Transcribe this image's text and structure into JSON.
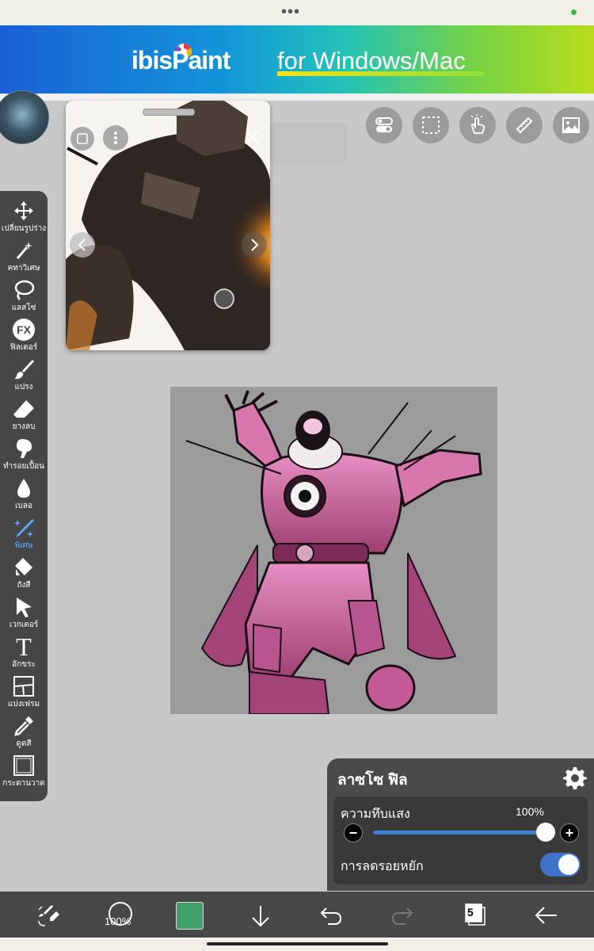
{
  "status_bar": {
    "dots": "•••",
    "indicator_color": "#2fbf4f"
  },
  "banner": {
    "brand": "ibisPaint",
    "slogan": "for Windows/Mac"
  },
  "toolbar": {
    "items": [
      {
        "label": "เปลี่ยนรูปร่าง",
        "icon": "move-arrows-icon"
      },
      {
        "label": "คทาวิเศษ",
        "icon": "magic-wand-icon"
      },
      {
        "label": "แลสโซ่",
        "icon": "lasso-icon"
      },
      {
        "label": "ฟิลเตอร์",
        "icon": "fx-filter-icon",
        "glyph": "FX"
      },
      {
        "label": "แปรง",
        "icon": "brush-icon"
      },
      {
        "label": "ยางลบ",
        "icon": "eraser-icon"
      },
      {
        "label": "ทำรอยเปื้อน",
        "icon": "smudge-icon"
      },
      {
        "label": "เบลอ",
        "icon": "blur-drop-icon"
      },
      {
        "label": "พิเศษ",
        "icon": "special-pen-icon",
        "active": true
      },
      {
        "label": "ถังสี",
        "icon": "fill-bucket-icon"
      },
      {
        "label": "เวกเตอร์",
        "icon": "vector-cursor-icon"
      },
      {
        "label": "อักขระ",
        "icon": "text-icon",
        "glyph": "T"
      },
      {
        "label": "แบ่งเฟรม",
        "icon": "frame-divider-icon"
      },
      {
        "label": "ดูดสี",
        "icon": "eyedropper-icon"
      },
      {
        "label": "กระดานวาด",
        "icon": "canvas-icon"
      }
    ]
  },
  "top_tools": [
    "toggle-icon",
    "selection-icon",
    "touch-icon",
    "ruler-icon",
    "image-icon"
  ],
  "lasso_fill": {
    "title": "ลาซโซ ฟิล",
    "opacity_label": "ความทึบแสง",
    "opacity_value": "100%",
    "opacity_fraction": 1.0,
    "minus": "−",
    "plus": "+",
    "antialias_label": "การลดรอยหยัก",
    "antialias_on": true
  },
  "bottom_bar": {
    "brush_size": "100%",
    "current_color": "#3fa06c",
    "layer_count": "5"
  }
}
